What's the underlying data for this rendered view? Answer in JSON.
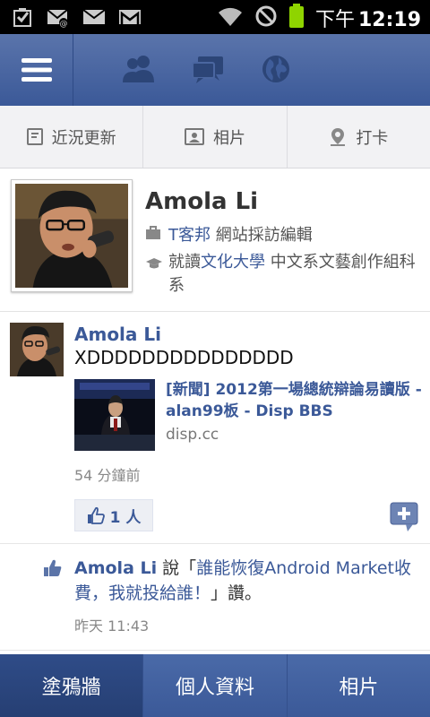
{
  "status_bar": {
    "time_prefix": "下午",
    "time": "12:19",
    "left_icons": [
      "download-complete-icon",
      "email-notification-icon",
      "mail-icon",
      "gmail-icon"
    ],
    "right_icons": [
      "wifi-icon",
      "do-not-disturb-icon",
      "battery-icon"
    ]
  },
  "top_nav": {
    "icons": [
      "menu-icon",
      "friends-icon",
      "messages-icon",
      "notifications-globe-icon"
    ]
  },
  "actions": [
    {
      "label": "近況更新",
      "icon": "status-update-icon"
    },
    {
      "label": "相片",
      "icon": "photo-icon"
    },
    {
      "label": "打卡",
      "icon": "check-in-icon"
    }
  ],
  "profile": {
    "name": "Amola Li",
    "work_company": "T客邦",
    "work_role": "網站採訪編輯",
    "edu_prefix": "就讀",
    "edu_school": "文化大學",
    "edu_detail": "中文系文藝創作組科系"
  },
  "post": {
    "author": "Amola Li",
    "text": "XDDDDDDDDDDDDDDD",
    "link_title": "[新聞] 2012第一場總統辯論易讀版 - alan99板 - Disp BBS",
    "link_domain": "disp.cc",
    "time": "54 分鐘前",
    "likes": "1 人"
  },
  "activity": {
    "author": "Amola Li",
    "said": "說「",
    "quote": "誰能恢復Android Market收費，我就投給誰！",
    "suffix": "」讚。",
    "time": "昨天 11:43"
  },
  "tabs": [
    {
      "label": "塗鴉牆",
      "active": true
    },
    {
      "label": "個人資料",
      "active": false
    },
    {
      "label": "相片",
      "active": false
    }
  ],
  "colors": {
    "brand": "#3b5998",
    "link": "#3b5998",
    "battery": "#8fd400"
  }
}
